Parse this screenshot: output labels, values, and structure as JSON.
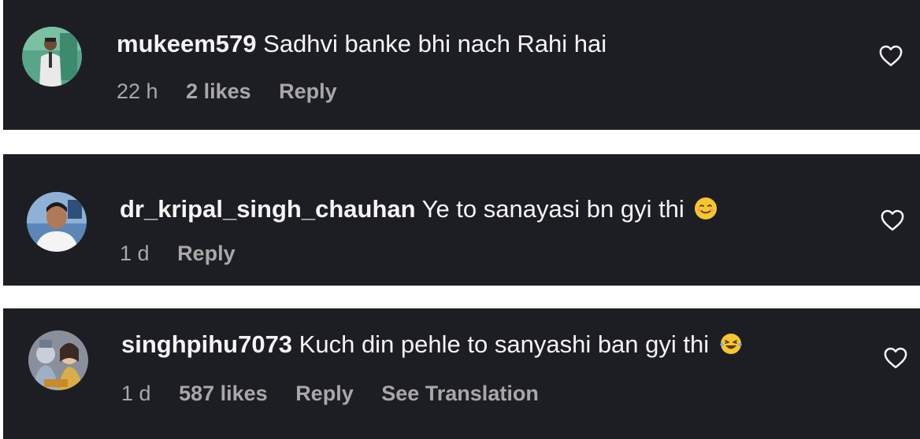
{
  "comments": [
    {
      "username": "mukeem579",
      "text": "Sadhvi banke bhi nach Rahi hai",
      "time": "22 h",
      "likes": "2 likes",
      "reply_label": "Reply",
      "avatar": "avatar-man-in-white-suit"
    },
    {
      "username": "dr_kripal_singh_chauhan",
      "text": "Ye to sanayasi bn gyi thi",
      "emoji": "smiling-face-emoji",
      "time": "1 d",
      "reply_label": "Reply",
      "avatar": "avatar-man-portrait"
    },
    {
      "username": "singhpihu7073",
      "text": "Kuch din pehle to sanyashi ban gyi thi",
      "emoji": "laughing-tears-emoji",
      "time": "1 d",
      "likes": "587 likes",
      "reply_label": "Reply",
      "translation_label": "See Translation",
      "avatar": "avatar-deity-illustration"
    }
  ],
  "icons": {
    "like": "heart-outline-icon"
  },
  "colors": {
    "card_background": "#1d1e23",
    "primary_text": "#f5f5f5",
    "secondary_text": "#a8a8a8",
    "page_background": "#ffffff"
  }
}
